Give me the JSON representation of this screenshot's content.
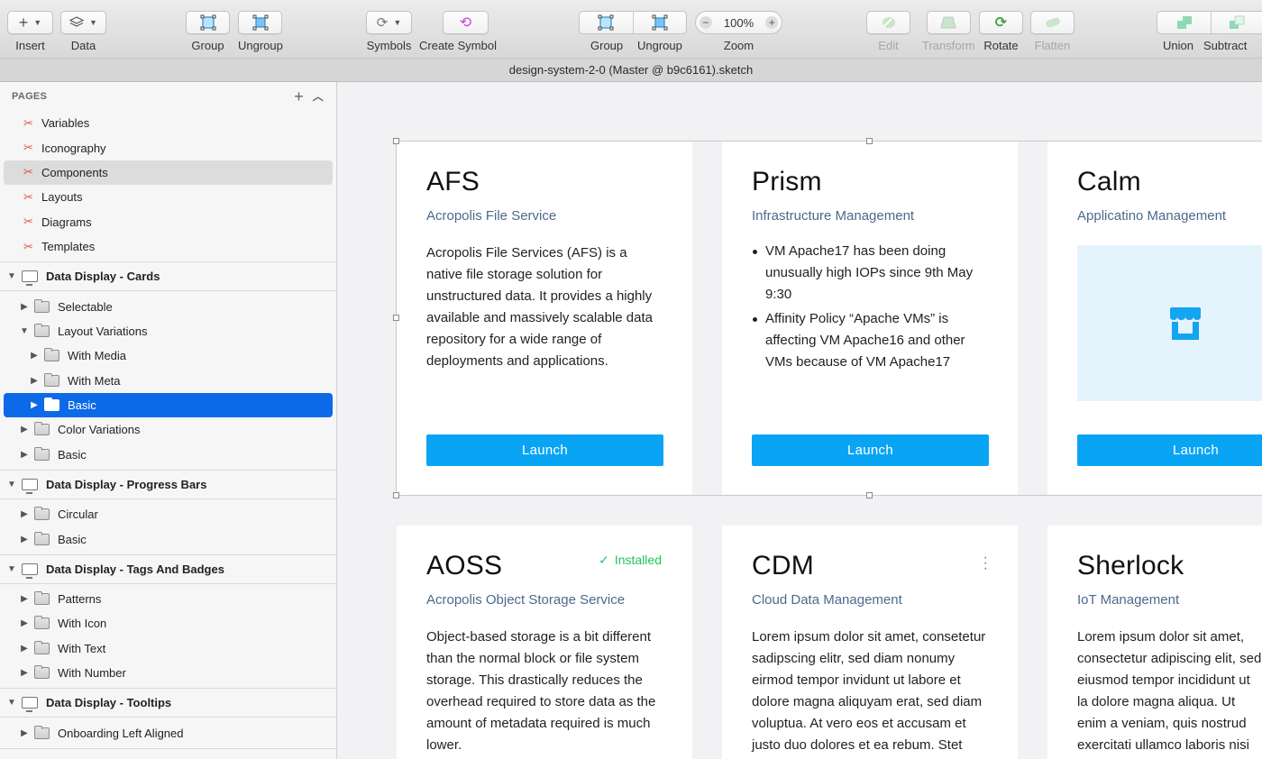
{
  "toolbar": {
    "insert": "Insert",
    "data": "Data",
    "group": "Group",
    "ungroup": "Ungroup",
    "symbols": "Symbols",
    "create_symbol": "Create Symbol",
    "group2": "Group",
    "ungroup2": "Ungroup",
    "zoom_label": "Zoom",
    "zoom_value": "100%",
    "zoom_minus": "−",
    "zoom_plus": "+",
    "edit": "Edit",
    "transform": "Transform",
    "rotate": "Rotate",
    "flatten": "Flatten",
    "union": "Union",
    "subtract": "Subtract"
  },
  "window": {
    "title": "design-system-2-0 (Master @ b9c6161).sketch"
  },
  "sidebar": {
    "pages_header": "PAGES",
    "pages": [
      {
        "label": "Variables"
      },
      {
        "label": "Iconography"
      },
      {
        "label": "Components"
      },
      {
        "label": "Layouts"
      },
      {
        "label": "Diagrams"
      },
      {
        "label": "Templates"
      }
    ],
    "artboards": [
      {
        "label": "Data Display - Cards",
        "groups": [
          {
            "label": "Selectable"
          },
          {
            "label": "Layout Variations"
          },
          {
            "label": "With Media"
          },
          {
            "label": "With Meta"
          },
          {
            "label": "Basic"
          },
          {
            "label": "Color Variations"
          },
          {
            "label": "Basic"
          }
        ]
      },
      {
        "label": "Data Display - Progress Bars",
        "groups": [
          {
            "label": "Circular"
          },
          {
            "label": "Basic"
          }
        ]
      },
      {
        "label": "Data Display - Tags And Badges",
        "groups": [
          {
            "label": "Patterns"
          },
          {
            "label": "With Icon"
          },
          {
            "label": "With Text"
          },
          {
            "label": "With Number"
          }
        ]
      },
      {
        "label": "Data Display - Tooltips",
        "groups": [
          {
            "label": "Onboarding Left Aligned"
          }
        ]
      }
    ]
  },
  "cards": [
    {
      "title": "AFS",
      "subtitle": "Acropolis File Service",
      "body": "Acropolis File Services (AFS) is a native file storage solution for unstructured data. It provides a highly available and massively scalable data repository for a wide range of deployments and applications.",
      "button": "Launch"
    },
    {
      "title": "Prism",
      "subtitle": "Infrastructure Management",
      "bullets": [
        "VM Apache17 has been doing unusually high IOPs since 9th May 9:30",
        "Affinity Policy “Apache VMs” is affecting VM Apache16 and other VMs because of VM Apache17"
      ],
      "button": "Launch"
    },
    {
      "title": "Calm",
      "subtitle": "Applicatino Management",
      "button": "Launch"
    },
    {
      "title": "AOSS",
      "subtitle": "Acropolis Object Storage Service",
      "badge": "Installed",
      "body": "Object-based storage is a bit different than the normal block or file system storage. This drastically reduces the overhead required to store data as the amount of metadata required is much lower."
    },
    {
      "title": "CDM",
      "subtitle": "Cloud Data Management",
      "body": "Lorem ipsum dolor sit amet, consetetur sadipscing elitr, sed diam nonumy eirmod tempor invidunt ut labore et dolore magna aliquyam erat, sed diam voluptua. At vero eos et accusam et justo duo dolores et ea rebum. Stet"
    },
    {
      "title": "Sherlock",
      "subtitle": "IoT Management",
      "body": "Lorem ipsum dolor sit amet, consectetur adipiscing elit, sed eiusmod tempor incididunt ut la dolore magna aliqua. Ut enim a veniam, quis nostrud exercitati ullamco laboris nisi ut aliquip e"
    }
  ],
  "colors": {
    "accent": "#0aa4f5",
    "selection": "#0c69e8",
    "installed": "#22c35e",
    "subtitle": "#4a6a8c"
  }
}
